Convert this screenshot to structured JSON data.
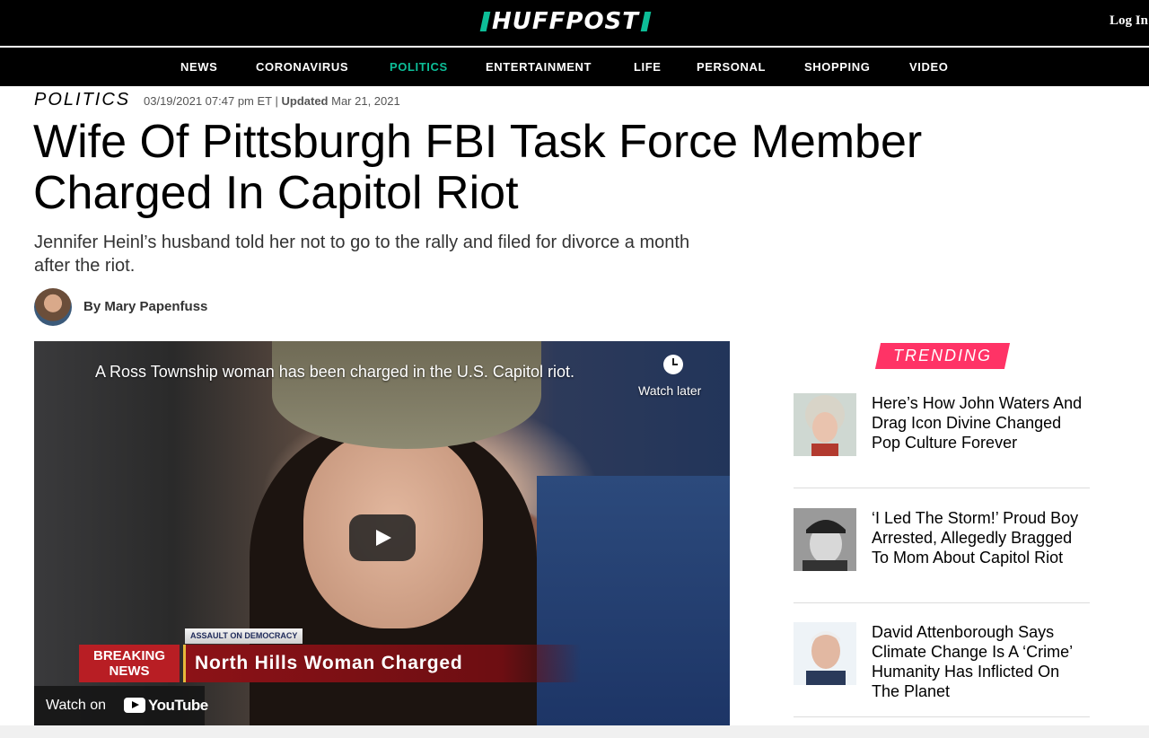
{
  "header": {
    "logo": "HUFFPOST",
    "login": "Log In",
    "accent_color": "#0dbe98"
  },
  "nav": {
    "items": [
      {
        "label": "NEWS",
        "active": false
      },
      {
        "label": "CORONAVIRUS",
        "active": false
      },
      {
        "label": "POLITICS",
        "active": true
      },
      {
        "label": "ENTERTAINMENT",
        "active": false
      },
      {
        "label": "LIFE",
        "active": false
      },
      {
        "label": "PERSONAL",
        "active": false
      },
      {
        "label": "SHOPPING",
        "active": false
      },
      {
        "label": "VIDEO",
        "active": false
      }
    ]
  },
  "article": {
    "section": "POLITICS",
    "date": "03/19/2021 07:47 pm ET |",
    "updated_label": "Updated",
    "updated_date": "Mar 21, 2021",
    "headline": "Wife Of Pittsburgh FBI Task Force Member Charged In Capitol Riot",
    "dek": "Jennifer Heinl’s husband told her not to go to the rally and filed for divorce a month after the riot.",
    "byline": "By Mary Papenfuss"
  },
  "video": {
    "title": "A Ross Township woman has been charged in the U.S. Capitol riot.",
    "watch_later": "Watch later",
    "ticker_tag": "ASSAULT ON DEMOCRACY",
    "breaking_line1": "BREAKING",
    "breaking_line2": "NEWS",
    "lower_third": "North Hills Woman Charged",
    "watch_on": "Watch on",
    "youtube": "YouTube"
  },
  "trending": {
    "label": "TRENDING",
    "accent_color": "#ff3366",
    "items": [
      {
        "title": "Here’s How John Waters And Drag Icon Divine Changed Pop Culture Forever",
        "thumb": "drag-queen-portrait"
      },
      {
        "title": "‘I Led The Storm!’ Proud Boy Arrested, Allegedly Bragged To Mom About Capitol Riot",
        "thumb": "man-in-cap-portrait"
      },
      {
        "title": "David Attenborough Says Climate Change Is A ‘Crime’ Humanity Has Inflicted On The Planet",
        "thumb": "elderly-man-portrait"
      }
    ]
  }
}
